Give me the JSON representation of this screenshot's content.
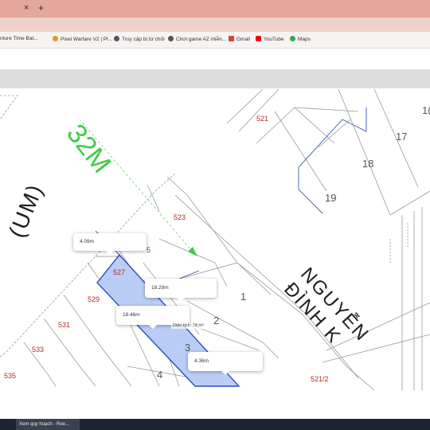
{
  "browser": {
    "tab_close": "×",
    "tab_new": "+",
    "bookmarks": [
      {
        "label": "nture Time Bat...",
        "icon": "game-icon",
        "color": "#8a6b3f"
      },
      {
        "label": "Pixel Warfare V2 | Pl...",
        "icon": "pixel-warfare-icon",
        "color": "#d89b2b"
      },
      {
        "label": "Truy cập bị từ chối",
        "icon": "globe-icon",
        "color": "#555555"
      },
      {
        "label": "Chơi game AZ miễn...",
        "icon": "globe-icon",
        "color": "#555555"
      },
      {
        "label": "Gmail",
        "icon": "gmail-icon",
        "color": "#d44638"
      },
      {
        "label": "YouTube",
        "icon": "youtube-icon",
        "color": "#ff0000"
      },
      {
        "label": "Maps",
        "icon": "maps-icon",
        "color": "#34a853"
      }
    ]
  },
  "map": {
    "road_32m": "32M",
    "road_left": "(UM)",
    "road_nguyen": "NGUYỄN ĐÌNH K",
    "parcels": {
      "p521": "521",
      "p523": "523",
      "p525": "5",
      "p527": "527",
      "p529": "529",
      "p531": "531",
      "p533": "533",
      "p535": "535",
      "p521_2": "521/2",
      "p17": "17",
      "p18": "18",
      "p19": "19",
      "p16": "1(",
      "p1": "1",
      "p2": "2",
      "p3": "3",
      "p4": "4"
    },
    "measurements": {
      "m1": "4.09m",
      "m2": "18.29m",
      "m3": "18.46m",
      "m4": "4.36m"
    },
    "area_label": "Diện tích: 78 m²",
    "highlight_color": "#b9cdf5"
  },
  "taskbar": {
    "item": "Xem quy hoạch - Ree..."
  }
}
